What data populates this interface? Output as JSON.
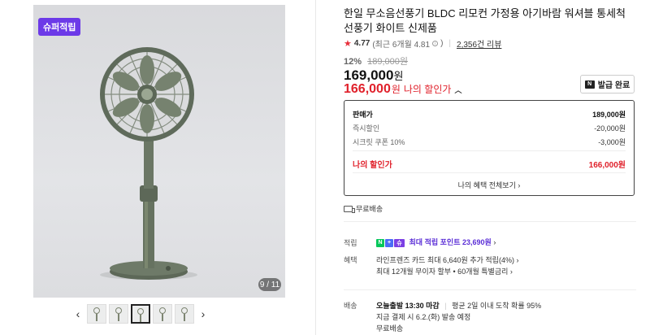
{
  "gallery": {
    "badge": "슈퍼적립",
    "counter": "9 / 11",
    "thumb_count": 5,
    "active_thumb": 3
  },
  "product": {
    "title": "한일 무소음선풍기 BLDC 리모컨 가정용 아기바람 워셔블 통세척 선풍기 화이트 신제품",
    "rating": "4.77",
    "rating_sub": "(최근 6개월 4.81",
    "rating_sub_end": ")",
    "reviews": "2,356건 리뷰",
    "discount_rate": "12%",
    "original_price": "189,000원",
    "price": "169,000",
    "price_unit": "원",
    "my_price": "166,000",
    "my_price_unit": "원",
    "my_price_label": "나의 할인가",
    "coupon_button": "발급 완료"
  },
  "price_box": {
    "sale_label": "판매가",
    "sale_value": "189,000원",
    "instant_label": "즉시할인",
    "instant_value": "-20,000원",
    "coupon_label": "시크릿 쿠폰 10%",
    "coupon_value": "-3,000원",
    "my_label": "나의 할인가",
    "my_value": "166,000원",
    "all_benefits": "나의 혜택 전체보기"
  },
  "shipping_free": "무료배송",
  "points": {
    "label": "적립",
    "text": "최대 적립 포인트 23,690원"
  },
  "benefits": {
    "label": "혜택",
    "line1": "라인프렌즈 카드 최대 6,640원 추가 적립(4%)",
    "line2": "최대 12개월 무이자 할부 • 60개월 특별금리"
  },
  "delivery": {
    "label": "배송",
    "today": "오늘출발 13:30 마감",
    "arrival": "평균 2일 이내 도착 확률 95%",
    "pay_now": "지금 결제 시 6.2.(화) 발송 예정",
    "free": "무료배송"
  },
  "colors": {
    "accent_red": "#e0212b",
    "badge_purple": "#6c3ae8",
    "fan_green": "#5f6b5b"
  }
}
